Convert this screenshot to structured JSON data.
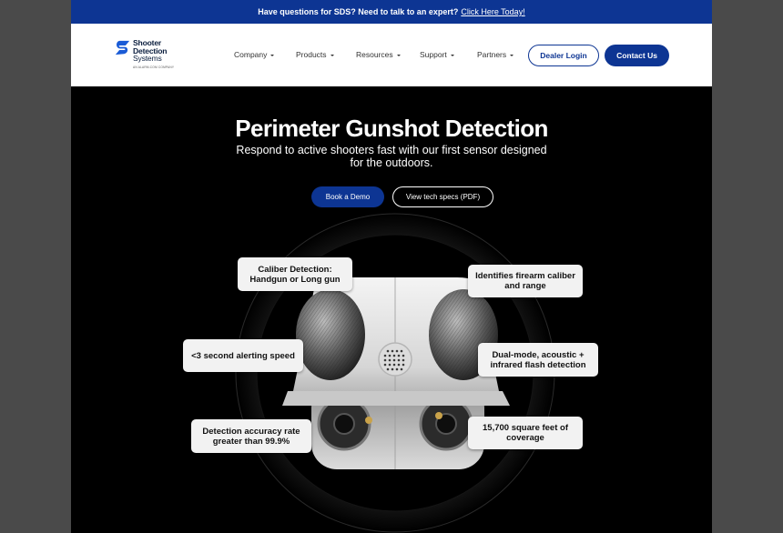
{
  "announcement": {
    "text": "Have questions for SDS? Need to talk to an expert?",
    "link": "Click Here Today!"
  },
  "logo": {
    "line1": "Shooter",
    "line2": "Detection",
    "line3": "Systems",
    "tagline": "AN ALARM.COM COMPANY",
    "brand_color": "#1a5bd6"
  },
  "nav": {
    "items": [
      {
        "label": "Company"
      },
      {
        "label": "Products"
      },
      {
        "label": "Resources"
      },
      {
        "label": "Support"
      },
      {
        "label": "Partners"
      }
    ],
    "dealer_login": "Dealer Login",
    "contact_us": "Contact Us"
  },
  "hero": {
    "title": "Perimeter Gunshot Detection",
    "subtitle": "Respond to active shooters fast with our first sensor designed for the outdoors.",
    "demo_button": "Book a Demo",
    "specs_button": "View tech specs (PDF)"
  },
  "callouts": {
    "caliber": "Caliber Detection: Handgun or Long gun",
    "identifies": "Identifies firearm caliber and range",
    "alerting": "<3 second alerting speed",
    "dual_mode": "Dual-mode, acoustic + infrared flash detection",
    "accuracy": "Detection accuracy rate greater than 99.9%",
    "coverage": "15,700 square feet of coverage"
  },
  "colors": {
    "primary": "#0d3593",
    "page_bg": "#000000",
    "frame_bg": "#4a4a4a"
  }
}
